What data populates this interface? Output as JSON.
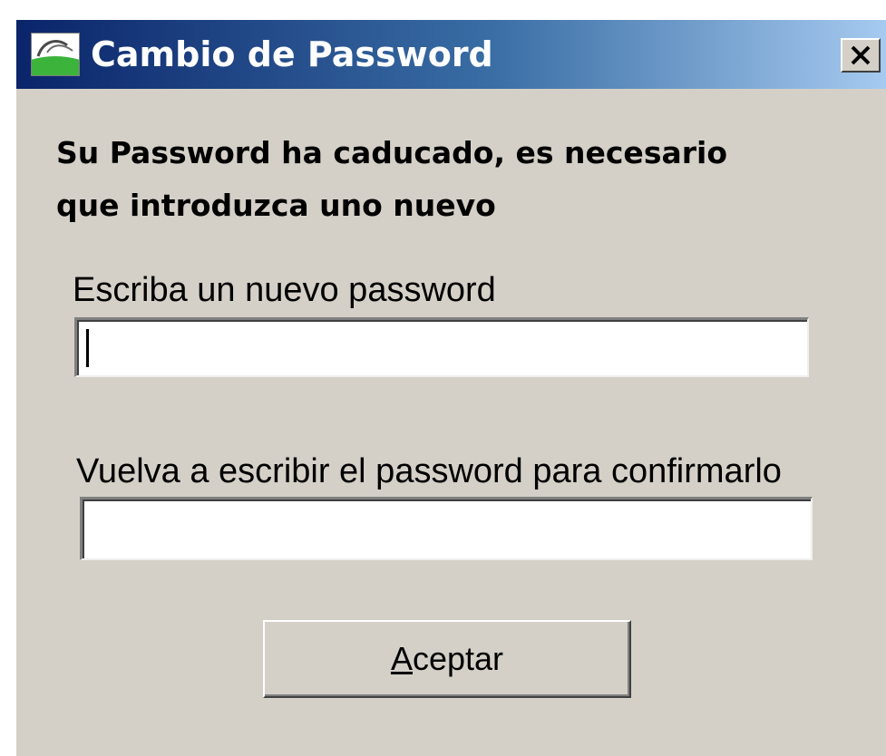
{
  "window": {
    "title": "Cambio de Password",
    "close_glyph": "✕"
  },
  "message": {
    "line1": "Su Password ha caducado, es necesario",
    "line2": "que introduzca uno nuevo"
  },
  "form": {
    "new_password": {
      "label": "Escriba un nuevo password",
      "value": ""
    },
    "confirm_password": {
      "label": "Vuelva a escribir el password para confirmarlo",
      "value": ""
    }
  },
  "accept_button": {
    "mnemonic": "A",
    "rest": "ceptar"
  },
  "colors": {
    "face": "#d4d0c8",
    "titlebar_start": "#0a246a",
    "titlebar_end": "#a6caf0"
  },
  "icons": {
    "app": "app-logo-icon",
    "close": "close-icon"
  }
}
